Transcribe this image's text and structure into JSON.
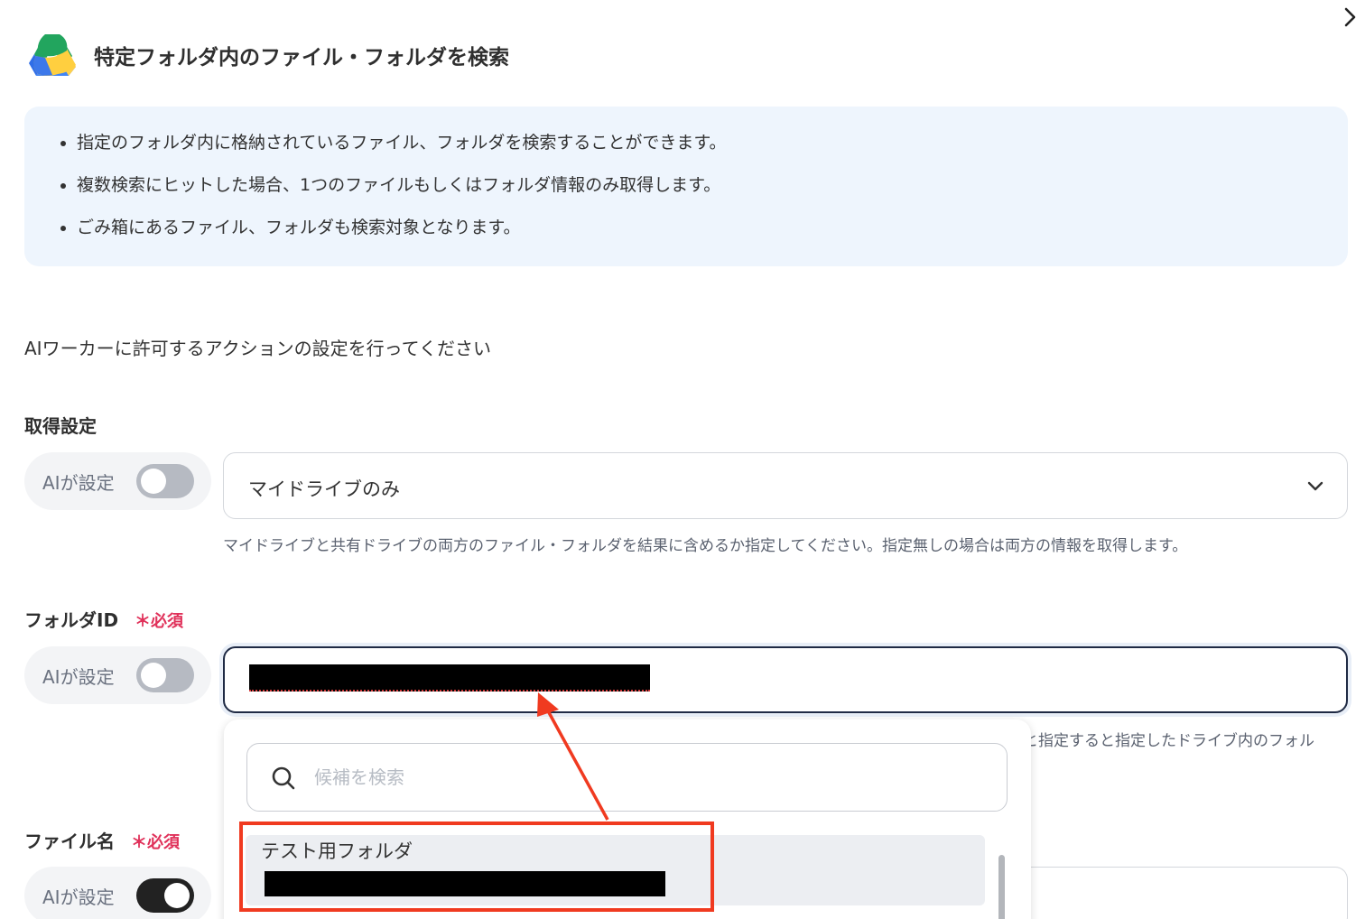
{
  "header": {
    "title": "特定フォルダ内のファイル・フォルダを検索",
    "close_icon": "chevron-right-icon"
  },
  "info": {
    "items": [
      "指定のフォルダ内に格納されているファイル、フォルダを検索することができます。",
      "複数検索にヒットした場合、1つのファイルもしくはフォルダ情報のみ取得します。",
      "ごみ箱にあるファイル、フォルダも検索対象となります。"
    ]
  },
  "intro": "AIワーカーに許可するアクションの設定を行ってください",
  "acquisition": {
    "label": "取得設定",
    "ai_label": "AIが設定",
    "ai_enabled": false,
    "selected": "マイドライブのみ",
    "help": "マイドライブと共有ドライブの両方のファイル・フォルダを結果に含めるか指定してください。指定無しの場合は両方の情報を取得します。"
  },
  "folder_id": {
    "label": "フォルダID",
    "required": "＊必須",
    "ai_label": "AIが設定",
    "ai_enabled": false,
    "help_partial": "と指定すると指定したドライブ内のフォル"
  },
  "dropdown": {
    "search_placeholder": "候補を検索",
    "options": [
      {
        "name": "テスト用フォルダ"
      }
    ]
  },
  "file_name": {
    "label": "ファイル名",
    "required": "＊必須",
    "ai_label": "AIが設定",
    "ai_enabled": true
  },
  "colors": {
    "accent_red": "#f03a20",
    "required": "#e0315a",
    "info_bg": "#eef5fd"
  }
}
